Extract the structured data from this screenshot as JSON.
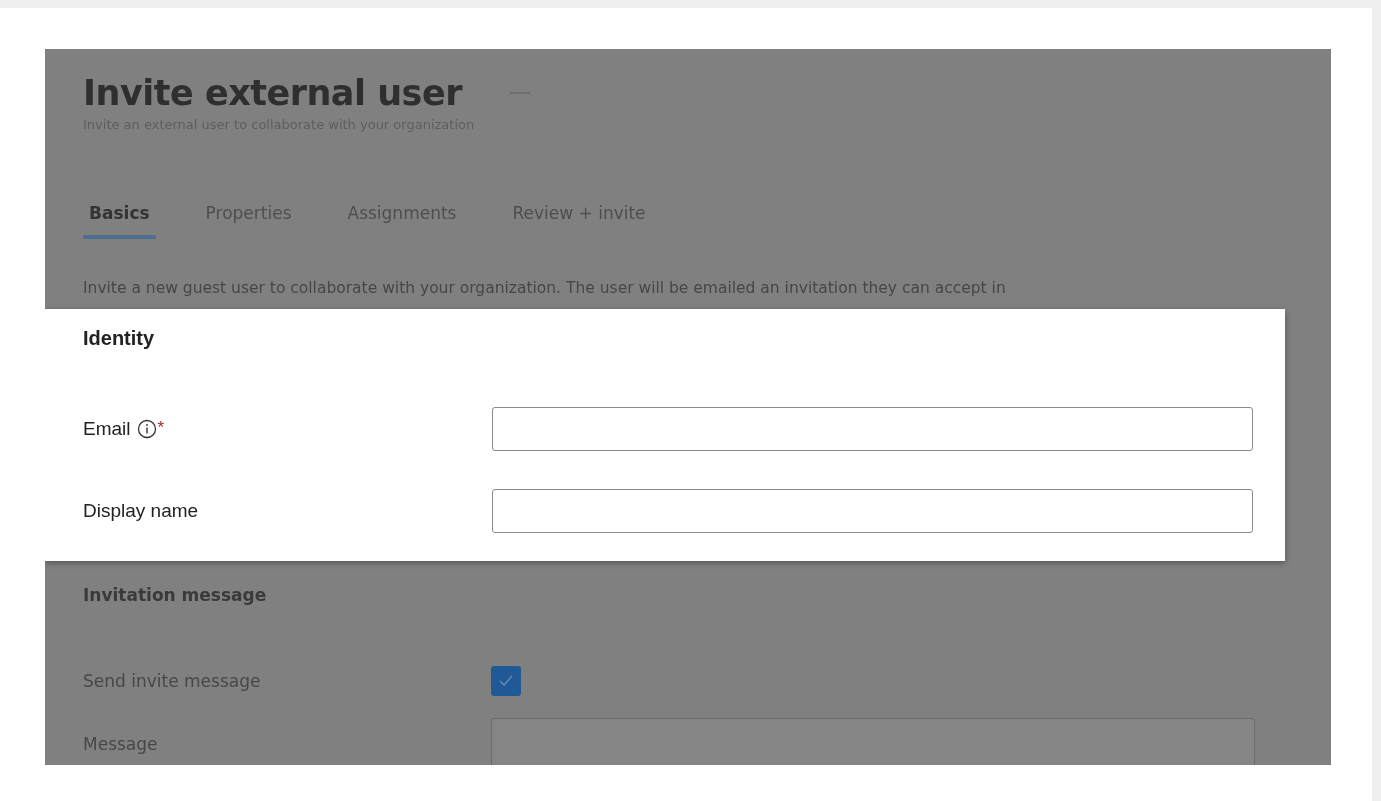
{
  "page": {
    "title": "Invite external user",
    "subtitle": "Invite an external user to collaborate with your organization"
  },
  "tabs": [
    {
      "label": "Basics",
      "selected": true
    },
    {
      "label": "Properties",
      "selected": false
    },
    {
      "label": "Assignments",
      "selected": false
    },
    {
      "label": "Review + invite",
      "selected": false
    }
  ],
  "description": "Invite a new guest user to collaborate with your organization. The user will be emailed an invitation they can accept in",
  "identity": {
    "heading": "Identity",
    "fields": [
      {
        "label": "Email",
        "info": true,
        "required_mark": "*"
      },
      {
        "label": "Display name",
        "info": false
      }
    ]
  },
  "invitation": {
    "heading": "Invitation message",
    "send_invite": {
      "label": "Send invite message",
      "checked": true
    },
    "message": {
      "label": "Message"
    }
  }
}
